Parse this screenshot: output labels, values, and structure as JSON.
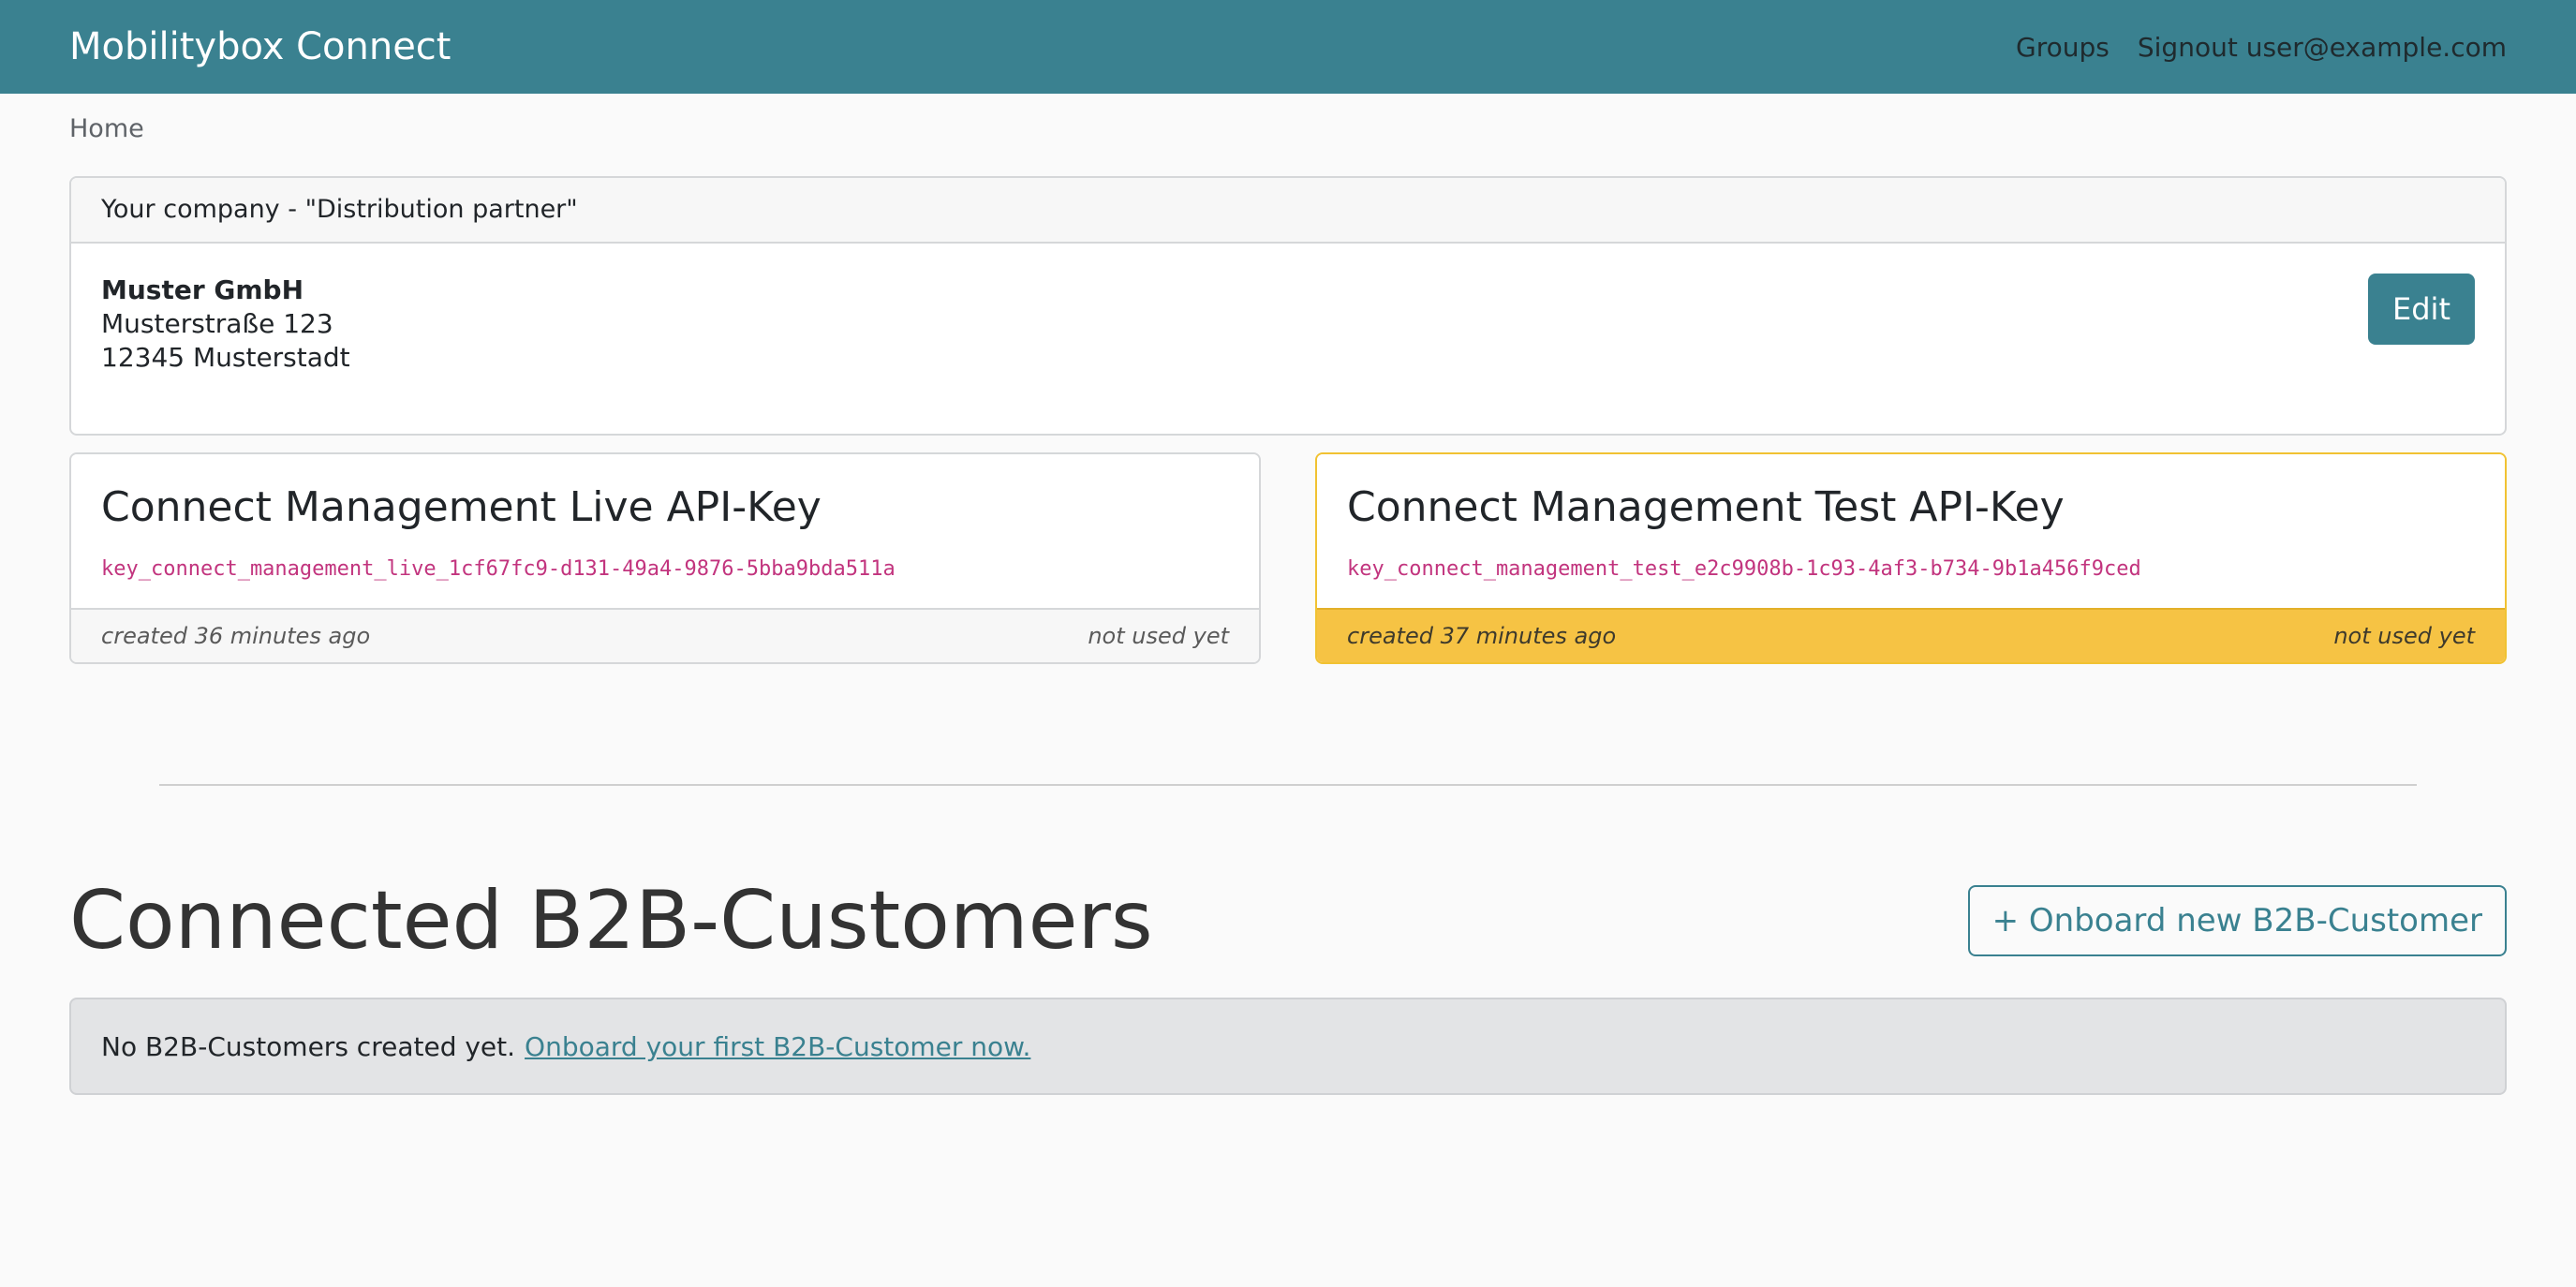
{
  "navbar": {
    "brand": "Mobilitybox Connect",
    "links": [
      {
        "label": "Groups"
      },
      {
        "label": "Signout user@example.com"
      }
    ]
  },
  "breadcrumb": {
    "current": "Home"
  },
  "company": {
    "header": "Your company - \"Distribution partner\"",
    "name": "Muster GmbH",
    "street": "Musterstraße 123",
    "city": "12345 Musterstadt",
    "edit_label": "Edit"
  },
  "api_keys": [
    {
      "title": "Connect Management Live API-Key",
      "key": "key_connect_management_live_1cf67fc9-d131-49a4-9876-5bba9bda511a",
      "created": "created 36 minutes ago",
      "usage": "not used yet"
    },
    {
      "title": "Connect Management Test API-Key",
      "key": "key_connect_management_test_e2c9908b-1c93-4af3-b734-9b1a456f9ced",
      "created": "created 37 minutes ago",
      "usage": "not used yet"
    }
  ],
  "customers": {
    "title": "Connected B2B-Customers",
    "onboard_button": "+ Onboard new B2B-Customer",
    "empty_text": "No B2B-Customers created yet.",
    "empty_link": "Onboard your first B2B-Customer now."
  },
  "colors": {
    "primary": "#3a8190",
    "warning": "#f6c344",
    "key_text": "#c2347e"
  }
}
